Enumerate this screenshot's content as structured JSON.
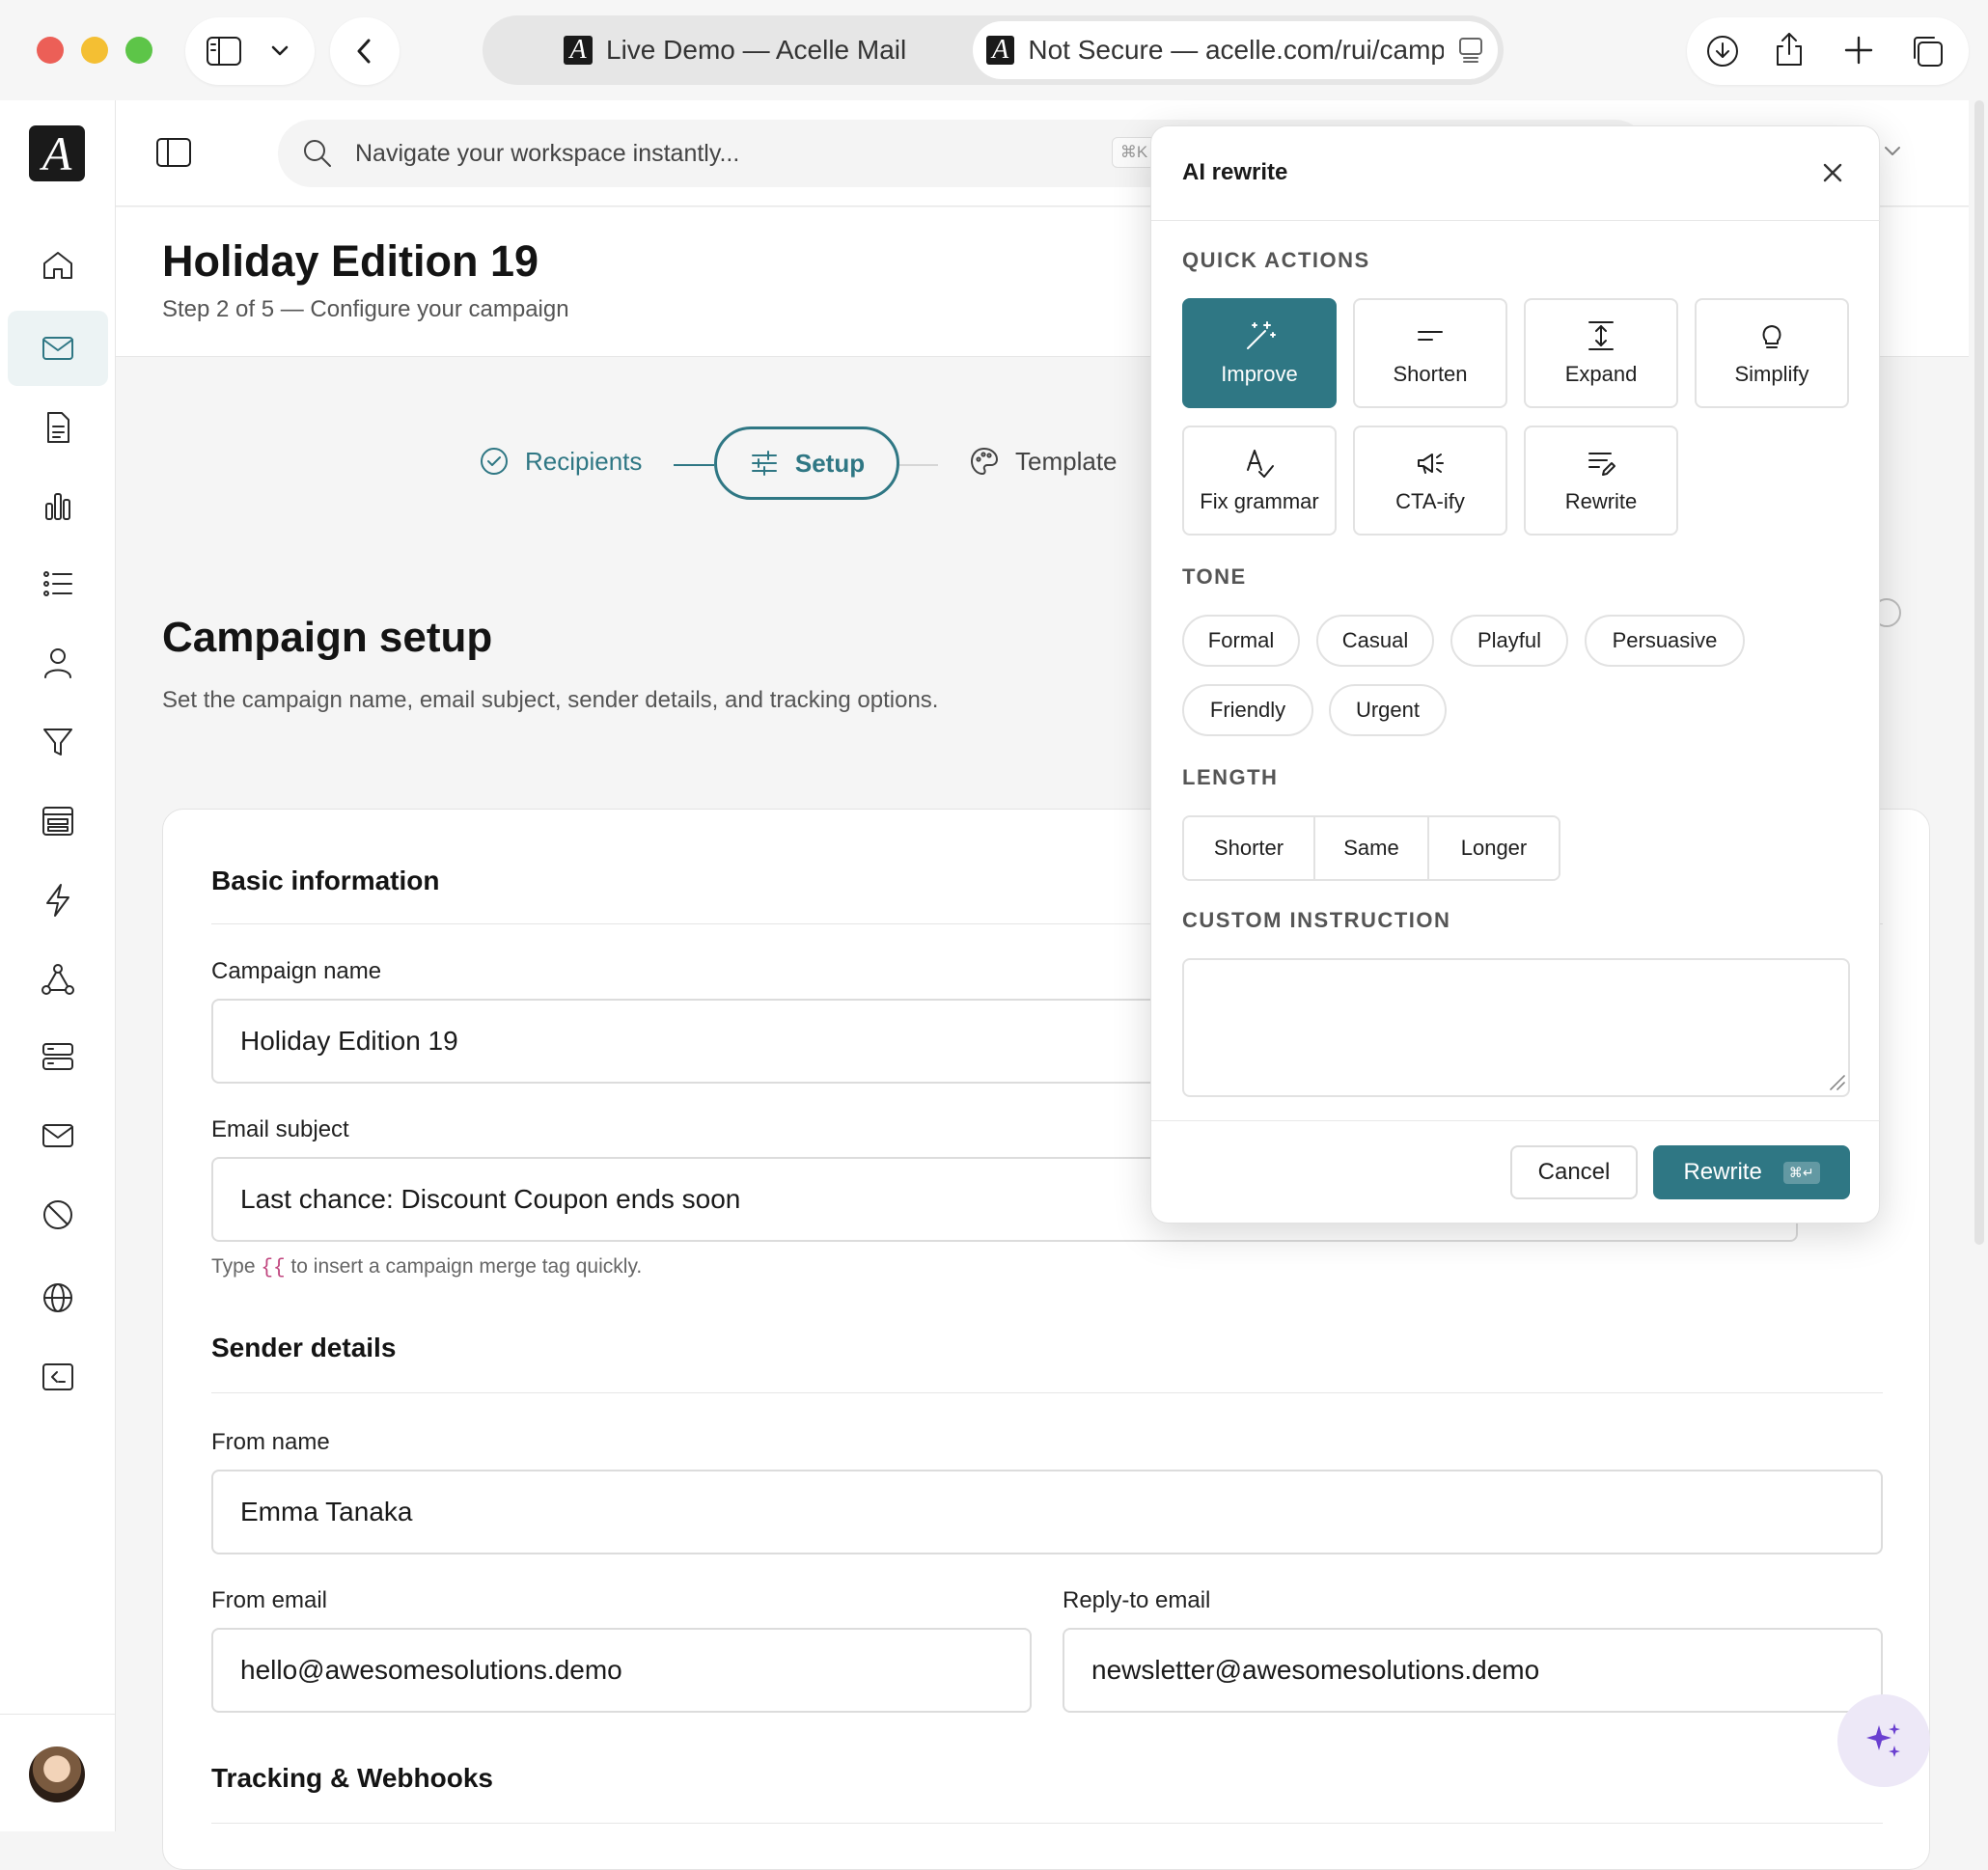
{
  "browser": {
    "tab1_title": "Live Demo — Acelle Mail",
    "tab2_title": "Not Secure — acelle.com/rui/campa",
    "favicon_letter": "A"
  },
  "app": {
    "logo_letter": "A",
    "search_placeholder": "Navigate your workspace instantly...",
    "search_shortcut": "⌘K"
  },
  "sidebar": {
    "items": [
      "home-icon",
      "mail-icon",
      "document-icon",
      "bar-chart-icon",
      "list-icon",
      "user-icon",
      "filter-icon",
      "template-icon",
      "bolt-icon",
      "network-icon",
      "server-icon",
      "envelope-icon",
      "blocked-icon",
      "globe-icon",
      "terminal-icon"
    ],
    "active_index": 1
  },
  "page": {
    "title": "Holiday Edition 19",
    "subtitle": "Step 2 of 5 — Configure your campaign"
  },
  "stepper": {
    "steps": [
      "Recipients",
      "Setup",
      "Template"
    ],
    "active": "Setup"
  },
  "setup": {
    "title": "Campaign setup",
    "description": "Set the campaign name, email subject, sender details, and tracking options."
  },
  "form": {
    "basic_title": "Basic information",
    "campaign_name_label": "Campaign name",
    "campaign_name_value": "Holiday Edition 19",
    "email_subject_label": "Email subject",
    "email_subject_value": "Last chance: Discount Coupon ends soon",
    "hint_before": "Type ",
    "hint_tag": "{{",
    "hint_after": " to insert a campaign merge tag quickly.",
    "sender_title": "Sender details",
    "from_name_label": "From name",
    "from_name_value": "Emma Tanaka",
    "from_email_label": "From email",
    "from_email_value": "hello@awesomesolutions.demo",
    "reply_to_label": "Reply-to email",
    "reply_to_value": "newsletter@awesomesolutions.demo",
    "tracking_title": "Tracking & Webhooks"
  },
  "ai_panel": {
    "title": "AI rewrite",
    "quick_actions_label": "QUICK ACTIONS",
    "quick_actions": [
      "Improve",
      "Shorten",
      "Expand",
      "Simplify",
      "Fix grammar",
      "CTA-ify",
      "Rewrite"
    ],
    "active_action": "Improve",
    "tone_label": "TONE",
    "tones": [
      "Formal",
      "Casual",
      "Playful",
      "Persuasive",
      "Friendly",
      "Urgent"
    ],
    "length_label": "LENGTH",
    "lengths": [
      "Shorter",
      "Same",
      "Longer"
    ],
    "custom_label": "CUSTOM INSTRUCTION",
    "custom_value": "",
    "cancel_label": "Cancel",
    "rewrite_label": "Rewrite",
    "rewrite_shortcut": "⌘↵"
  },
  "colors": {
    "accent": "#2f7784",
    "accent_light": "#ecf3f4",
    "fab_bg": "#ede8f7",
    "fab_icon": "#6a3fd0"
  }
}
